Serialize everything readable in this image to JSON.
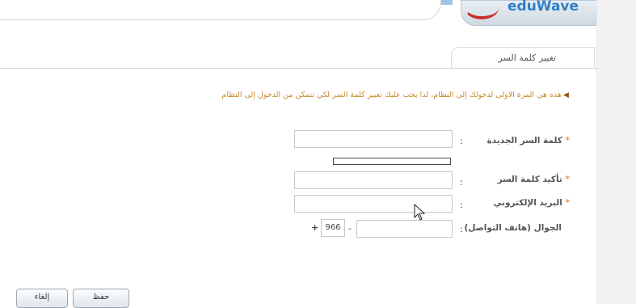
{
  "header": {
    "logo_text": "eduWave"
  },
  "tab": {
    "title": "تغيير كلمة السر"
  },
  "notice": {
    "text": "هذه هي المرة الاولى لدخولك إلى النظام، لذا يجب عليك تغيير كلمة السر لكي تتمكن من الدخول إلى النظام"
  },
  "form": {
    "new_password_label": "كلمة السر الجديدة",
    "confirm_password_label": "تأكيد كلمة السر",
    "email_label": "البريد الإلكتروني",
    "mobile_label": "الجوال (هاتف التواصل)",
    "required_mark": "*",
    "colon": ":",
    "country_code": "966",
    "dash": "-",
    "plus": "+"
  },
  "buttons": {
    "save": "حفظ",
    "cancel": "إلغاء"
  }
}
